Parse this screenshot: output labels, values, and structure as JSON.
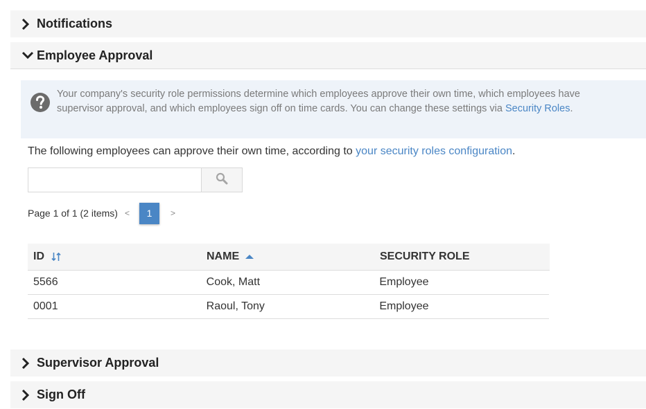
{
  "sections": {
    "notifications": "Notifications",
    "employee_approval": "Employee Approval",
    "supervisor_approval": "Supervisor Approval",
    "sign_off": "Sign Off"
  },
  "info": {
    "text": "Your company's security role permissions determine which employees approve their own time, which employees have supervisor approval, and which employees sign off on time cards. You can change these settings via ",
    "link": "Security Roles",
    "end": "."
  },
  "approve_line": {
    "text": "The following employees can approve their own time, according to ",
    "link": "your security roles configuration",
    "end": "."
  },
  "search": {
    "value": "",
    "placeholder": ""
  },
  "pager": {
    "summary": "Page 1 of 1 (2 items)",
    "prev": "<",
    "current": "1",
    "next": ">"
  },
  "table": {
    "columns": [
      "ID",
      "NAME",
      "SECURITY ROLE"
    ],
    "rows": [
      [
        "5566",
        "Cook, Matt",
        "Employee"
      ],
      [
        "0001",
        "Raoul, Tony",
        "Employee"
      ]
    ]
  },
  "colors": {
    "accent": "#4a86c5",
    "header_bg": "#f5f5f5",
    "info_bg": "#eef3f9"
  }
}
